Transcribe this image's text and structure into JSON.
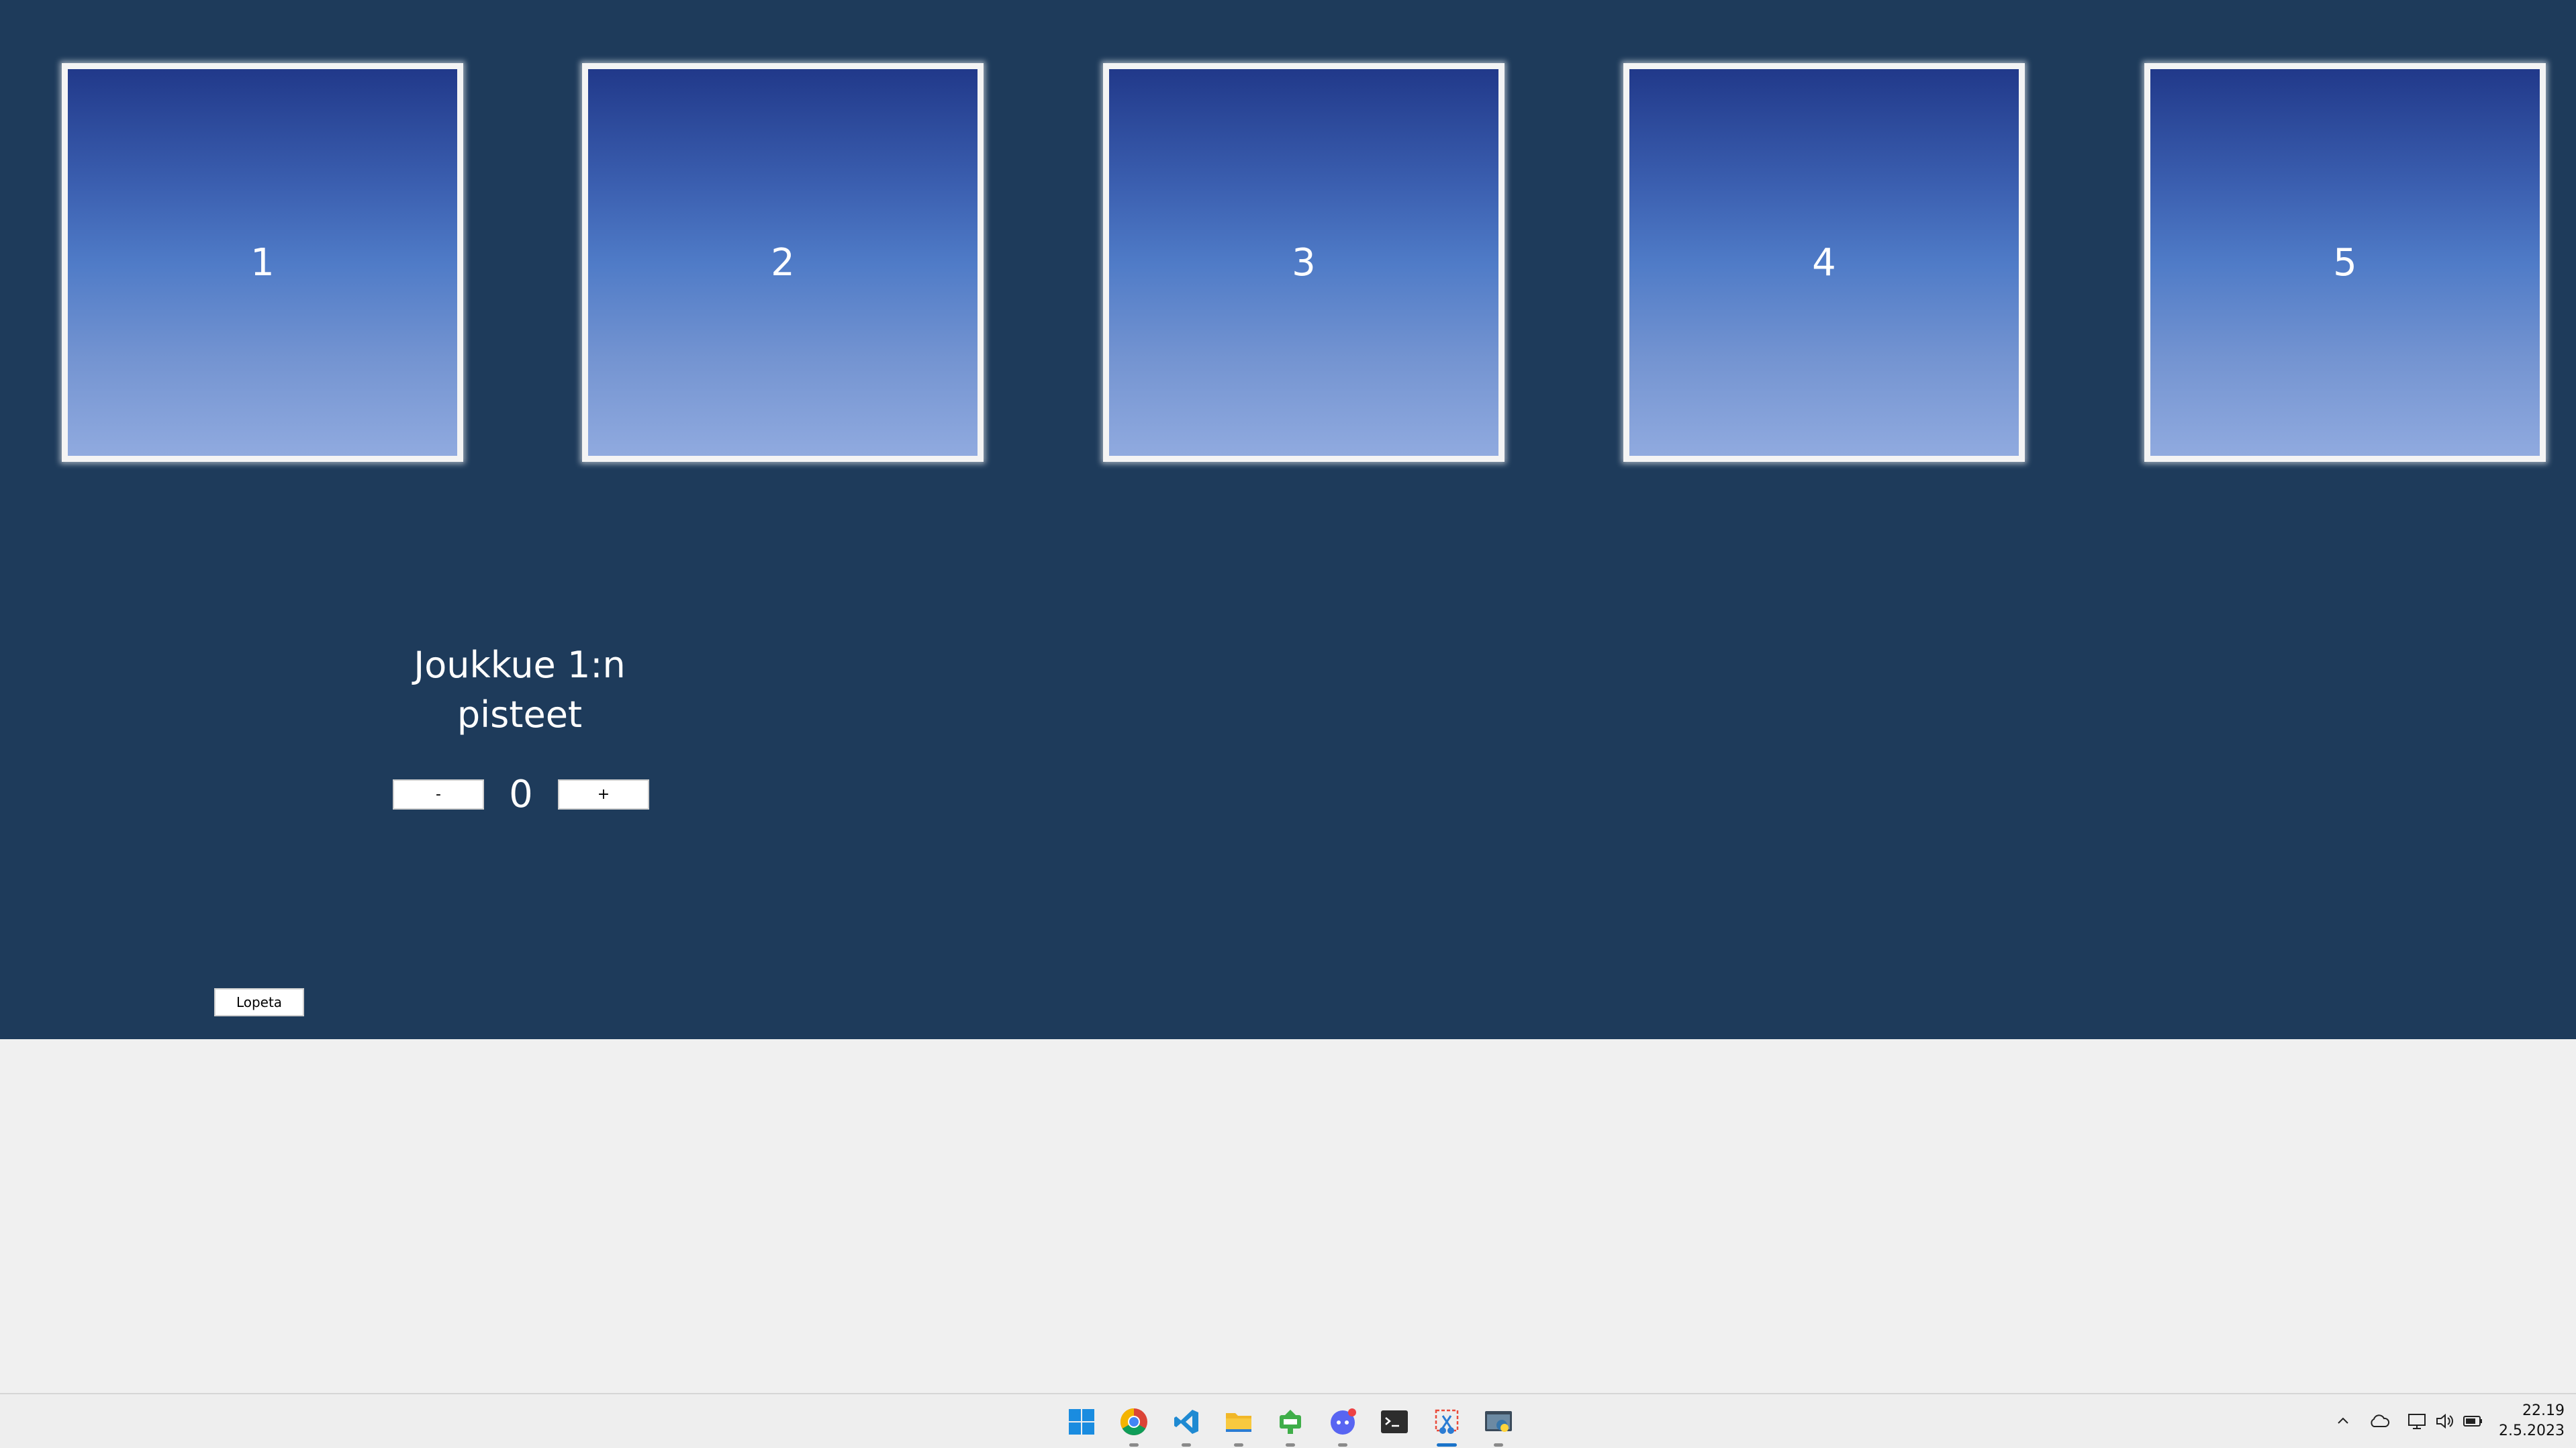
{
  "cards": [
    {
      "label": "1"
    },
    {
      "label": "2"
    },
    {
      "label": "3"
    },
    {
      "label": "4"
    },
    {
      "label": "5"
    }
  ],
  "score": {
    "title_line1": "Joukkue 1:n",
    "title_line2": "pisteet",
    "minus_label": "-",
    "plus_label": "+",
    "value": "0"
  },
  "quit_label": "Lopeta",
  "colors": {
    "background": "#1e3b5b",
    "card_top": "#21398a",
    "card_bottom": "#90aadf",
    "card_border": "#f4f4f4",
    "taskbar": "#eeeeee"
  },
  "taskbar": {
    "apps": [
      {
        "icon": "windows-start-icon"
      },
      {
        "icon": "chrome-icon"
      },
      {
        "icon": "vscode-icon"
      },
      {
        "icon": "file-explorer-icon"
      },
      {
        "icon": "green-app-icon"
      },
      {
        "icon": "discord-icon"
      },
      {
        "icon": "terminal-icon"
      },
      {
        "icon": "snipping-tool-icon"
      },
      {
        "icon": "python-app-icon"
      }
    ],
    "tray_icons": [
      "chevron-up-icon",
      "cloud-icon",
      "network-icon",
      "volume-icon",
      "battery-icon"
    ],
    "time": "22.19",
    "date": "2.5.2023"
  }
}
